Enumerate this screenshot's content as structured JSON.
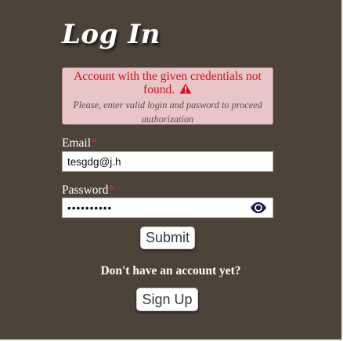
{
  "header": {
    "title": "Log In"
  },
  "alert": {
    "message": "Account with the given credentials not found.",
    "icon": "warning-icon",
    "detail": "Please, enter valid login and pasword to proceed authorization",
    "color": "#d41219",
    "background": "#e7c5c8"
  },
  "form": {
    "email_label": "Email",
    "email_value": "tesgdg@j.h",
    "password_label": "Password",
    "password_value": "••••••••••",
    "required_marker": "*",
    "reveal_icon": "eye-icon",
    "submit_label": "Submit"
  },
  "footer": {
    "prompt": "Don't have an account yet?",
    "signup_label": "Sign Up"
  },
  "colors": {
    "background": "#4d4439",
    "required": "#e4253a",
    "eye_icon": "#1c1c4a"
  }
}
